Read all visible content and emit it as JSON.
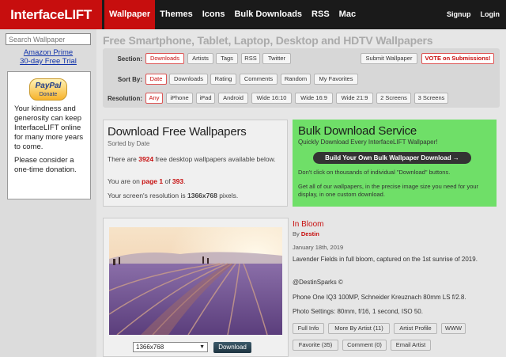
{
  "header": {
    "logo": "InterfaceLIFT",
    "nav": [
      "Wallpaper",
      "Themes",
      "Icons",
      "Bulk Downloads",
      "RSS",
      "Mac"
    ],
    "signup": "Signup",
    "login": "Login"
  },
  "sidebar": {
    "search_placeholder": "Search Wallpaper",
    "amazon_line1": "Amazon Prime",
    "amazon_line2": "30-day Free Trial",
    "paypal_logo": "PayPal",
    "paypal_donate": "Donate",
    "donate_text1": "Your kindness and generosity can keep InterfaceLIFT online for many more years to come.",
    "donate_text2": "Please consider a one-time donation."
  },
  "headline": "Free Smartphone, Tablet, Laptop, Desktop and HDTV Wallpapers",
  "filters": {
    "section_label": "Section:",
    "section": [
      "Downloads",
      "Artists",
      "Tags",
      "RSS",
      "Twitter"
    ],
    "submit": "Submit Wallpaper",
    "vote": "VOTE on Submissions!",
    "sortby_label": "Sort By:",
    "sortby": [
      "Date",
      "Downloads",
      "Rating",
      "Comments",
      "Random",
      "My Favorites"
    ],
    "resolution_label": "Resolution:",
    "resolution": [
      "Any",
      "iPhone",
      "iPad",
      "Android",
      "Wide 16:10",
      "Wide 16:9",
      "Wide 21:9",
      "2 Screens",
      "3 Screens"
    ]
  },
  "info": {
    "title": "Download Free Wallpapers",
    "subtitle": "Sorted by Date",
    "line1_pre": "There are ",
    "count": "3924",
    "line1_post": " free desktop wallpapers available below.",
    "line2_pre": "You are on ",
    "page": "page 1",
    "line2_mid": " of ",
    "pages": "393",
    "line2_post": ".",
    "line3_pre": "Your screen's resolution is ",
    "resolution": "1366x768",
    "line3_post": " pixels."
  },
  "bulk": {
    "title": "Bulk Download Service",
    "subtitle": "Quickly Download Every InterfaceLIFT Wallpaper!",
    "button": "Build Your Own Bulk Wallpaper Download →",
    "text1": "Don't click on thousands of individual \"Download\" buttons.",
    "text2": "Get all of our wallpapers, in the precise image size you need for your display, in one custom download."
  },
  "wallpaper": {
    "resolution_select": "1366x768",
    "download": "Download",
    "title": "In Bloom",
    "by_label": "By",
    "author": "Destin",
    "date": "January 18th, 2019",
    "description": "Lavender Fields in full bloom, captured on the 1st sunrise of 2019.",
    "credit": "@DestinSparks ©",
    "camera": "Phone One IQ3 100MP, Schneider Kreuznach 80mm LS f/2.8.",
    "settings": "Photo Settings: 80mm, f/16, 1 second, ISO 50.",
    "actions_row1": [
      "Full Info",
      "More By Artist (11)",
      "Artist Profile",
      "WWW"
    ],
    "actions_row2": [
      "Favorite (35)",
      "Comment (0)",
      "Email Artist"
    ]
  },
  "colors": {
    "brand_red": "#c70e0e",
    "bulk_green": "#6fdf68",
    "topbar": "#1a1a1a"
  }
}
